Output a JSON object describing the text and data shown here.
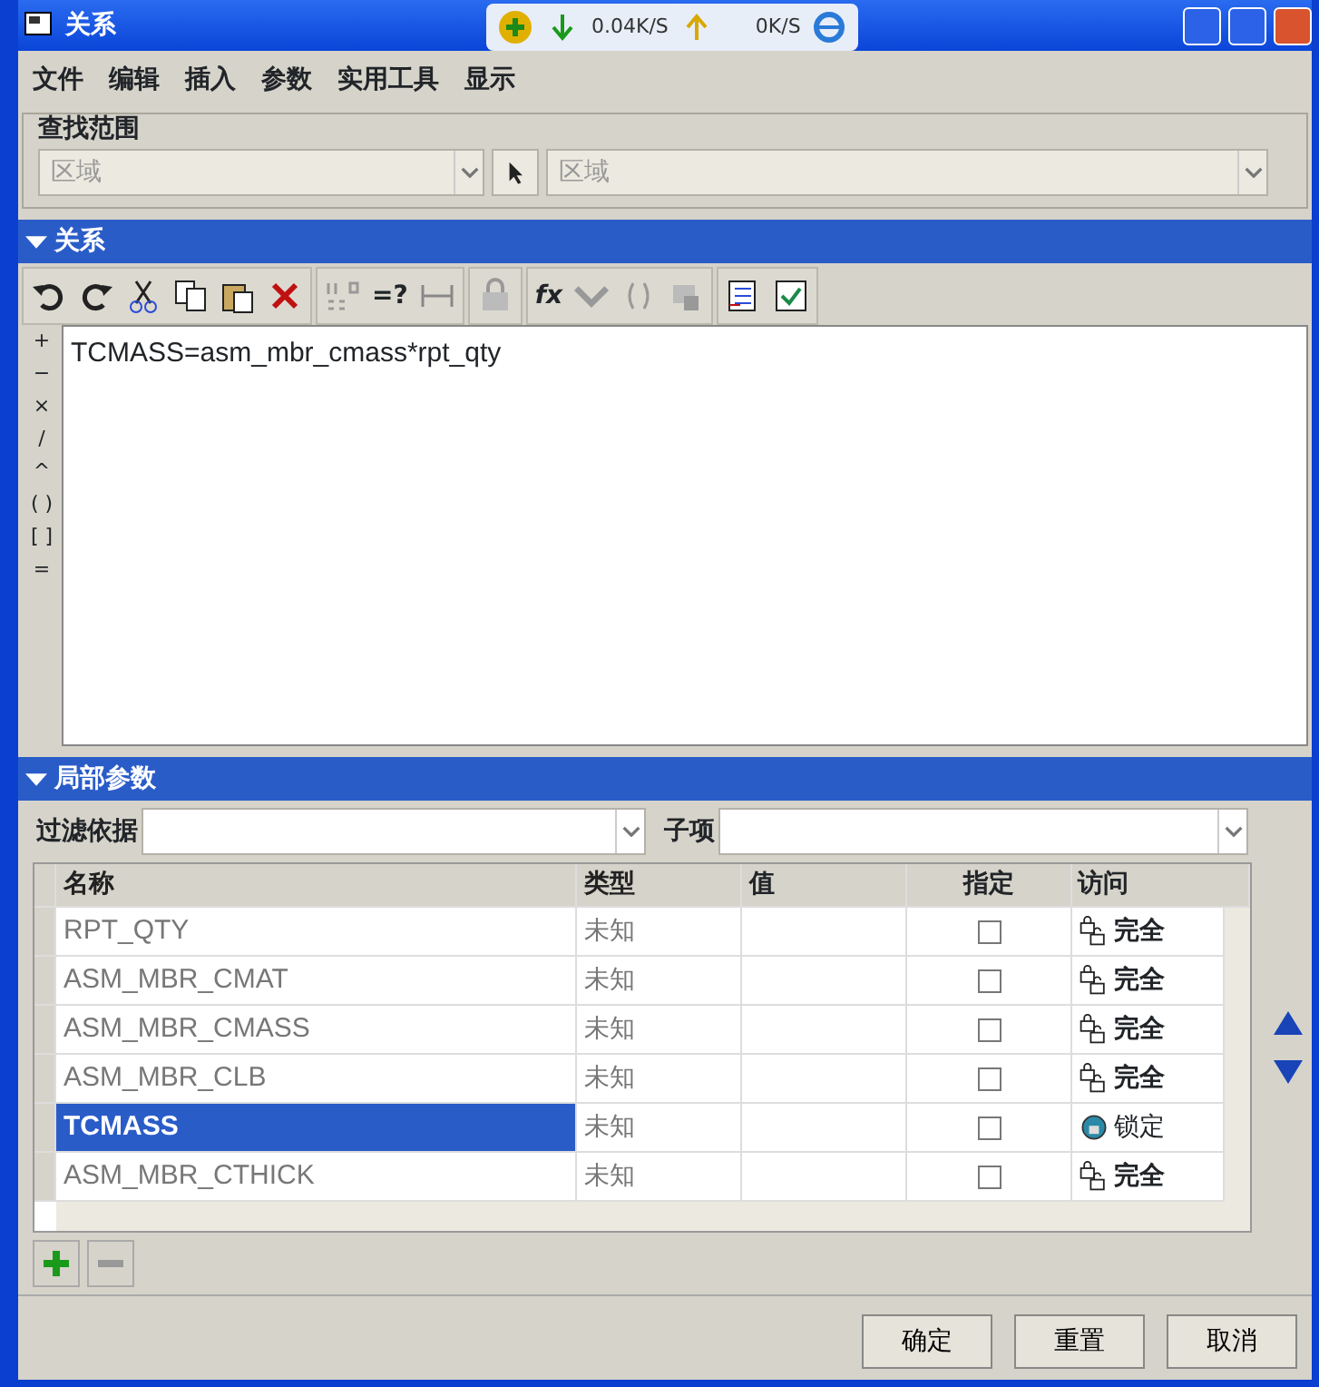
{
  "window": {
    "title": "关系"
  },
  "network_widget": {
    "download": "0.04K/S",
    "upload": "0K/S"
  },
  "menu": [
    "文件",
    "编辑",
    "插入",
    "参数",
    "实用工具",
    "显示"
  ],
  "scope": {
    "title": "查找范围",
    "field_1": "区域",
    "field_2": "区域"
  },
  "relations": {
    "title": "关系",
    "expanded": true,
    "text": "TCMASS=asm_mbr_cmass*rpt_qty",
    "toolbar_texts": [
      "=?",
      "fx"
    ],
    "operators": [
      "+",
      "−",
      "×",
      "/",
      "^",
      "( )",
      "[ ]",
      "="
    ]
  },
  "local_params": {
    "title": "局部参数",
    "expanded": true,
    "filter_label": "过滤依据",
    "sub_label": "子项",
    "columns": [
      "名称",
      "类型",
      "值",
      "指定",
      "访问"
    ],
    "rows": [
      {
        "name": "RPT_QTY",
        "type": "未知",
        "checked": false,
        "access": "完全",
        "kind": "full",
        "selected": false
      },
      {
        "name": "ASM_MBR_CMAT",
        "type": "未知",
        "checked": false,
        "access": "完全",
        "kind": "full",
        "selected": false
      },
      {
        "name": "ASM_MBR_CMASS",
        "type": "未知",
        "checked": false,
        "access": "完全",
        "kind": "full",
        "selected": false
      },
      {
        "name": "ASM_MBR_CLB",
        "type": "未知",
        "checked": false,
        "access": "完全",
        "kind": "full",
        "selected": false
      },
      {
        "name": "TCMASS",
        "type": "未知",
        "checked": false,
        "access": "锁定",
        "kind": "locked",
        "selected": true
      },
      {
        "name": "ASM_MBR_CTHICK",
        "type": "未知",
        "checked": false,
        "access": "完全",
        "kind": "full",
        "selected": false
      }
    ]
  },
  "buttons": [
    "确定",
    "重置",
    "取消"
  ]
}
